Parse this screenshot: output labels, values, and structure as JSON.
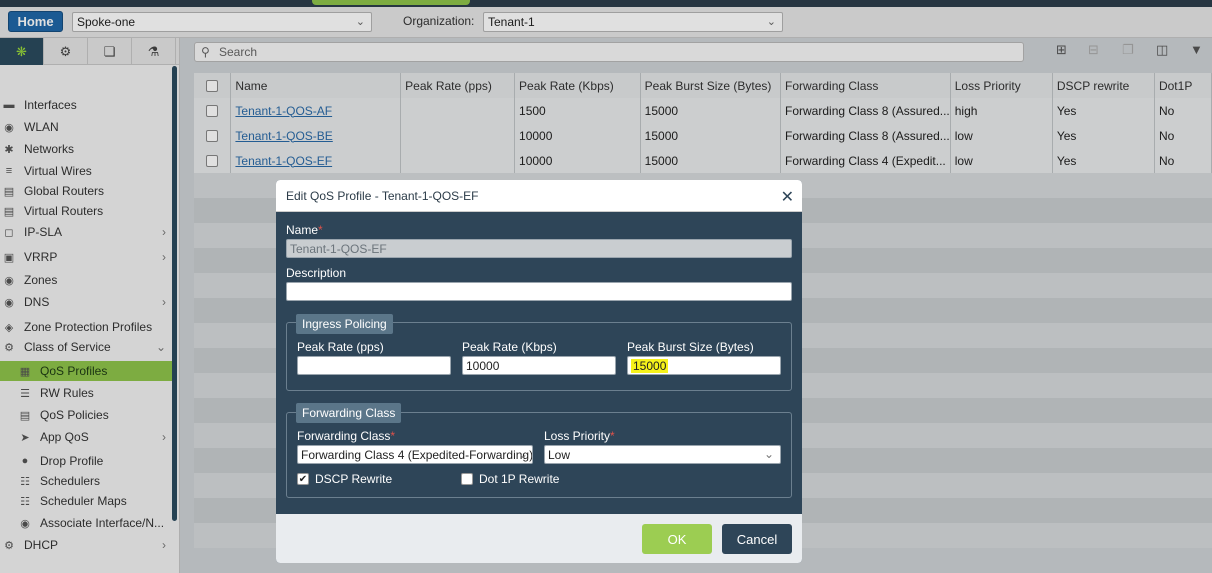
{
  "toolbar": {
    "home": "Home",
    "device": "Spoke-one",
    "org_label": "Organization:",
    "org": "Tenant-1"
  },
  "sidebar": {
    "items": [
      {
        "label": "Interfaces",
        "icon": "interface-icon",
        "has_arrow": false
      },
      {
        "label": "WLAN",
        "icon": "wifi-icon",
        "has_arrow": false
      },
      {
        "label": "Networks",
        "icon": "network-icon",
        "has_arrow": false
      },
      {
        "label": "Virtual Wires",
        "icon": "wire-icon",
        "has_arrow": false
      },
      {
        "label": "Global Routers",
        "icon": "router-icon",
        "has_arrow": false
      },
      {
        "label": "Virtual Routers",
        "icon": "router-icon",
        "has_arrow": false
      },
      {
        "label": "IP-SLA",
        "icon": "sla-icon",
        "has_arrow": true
      },
      {
        "label": "VRRP",
        "icon": "vrrp-icon",
        "has_arrow": true
      },
      {
        "label": "Zones",
        "icon": "zones-icon",
        "has_arrow": false
      },
      {
        "label": "DNS",
        "icon": "dns-icon",
        "has_arrow": true
      },
      {
        "label": "Zone Protection Profiles",
        "icon": "shield-icon",
        "has_arrow": false
      },
      {
        "label": "Class of Service",
        "icon": "cos-icon",
        "has_arrow": true
      },
      {
        "label": "QoS Profiles",
        "icon": "qos-icon",
        "has_arrow": false
      },
      {
        "label": "RW Rules",
        "icon": "rules-icon",
        "has_arrow": false
      },
      {
        "label": "QoS Policies",
        "icon": "policy-icon",
        "has_arrow": false
      },
      {
        "label": "App QoS",
        "icon": "app-icon",
        "has_arrow": true
      },
      {
        "label": "Drop Profile",
        "icon": "drop-icon",
        "has_arrow": false
      },
      {
        "label": "Schedulers",
        "icon": "scheduler-icon",
        "has_arrow": false
      },
      {
        "label": "Scheduler Maps",
        "icon": "map-icon",
        "has_arrow": false
      },
      {
        "label": "Associate Interface/N...",
        "icon": "associate-icon",
        "has_arrow": false
      },
      {
        "label": "DHCP",
        "icon": "dhcp-icon",
        "has_arrow": true
      }
    ]
  },
  "search": {
    "placeholder": "Search"
  },
  "table": {
    "headers": [
      "Name",
      "Peak Rate (pps)",
      "Peak Rate (Kbps)",
      "Peak Burst Size (Bytes)",
      "Forwarding Class",
      "Loss Priority",
      "DSCP rewrite",
      "Dot1P"
    ],
    "rows": [
      [
        "Tenant-1-QOS-AF",
        "",
        "1500",
        "15000",
        "Forwarding Class 8 (Assured...",
        "high",
        "Yes",
        "No"
      ],
      [
        "Tenant-1-QOS-BE",
        "",
        "10000",
        "15000",
        "Forwarding Class 8 (Assured...",
        "low",
        "Yes",
        "No"
      ],
      [
        "Tenant-1-QOS-EF",
        "",
        "10000",
        "15000",
        "Forwarding Class 4 (Expedit...",
        "low",
        "Yes",
        "No"
      ]
    ]
  },
  "modal": {
    "title": "Edit QoS Profile - Tenant-1-QOS-EF",
    "name_label": "Name",
    "name_value": "Tenant-1-QOS-EF",
    "desc_label": "Description",
    "desc_value": "",
    "ingress_legend": "Ingress Policing",
    "pps_label": "Peak Rate (pps)",
    "pps_value": "",
    "kbps_label": "Peak Rate (Kbps)",
    "kbps_value": "10000",
    "burst_label": "Peak Burst Size (Bytes)",
    "burst_value": "15000",
    "fc_legend": "Forwarding Class",
    "fc_label": "Forwarding Class",
    "fc_value": "Forwarding Class 4 (Expedited-Forwarding)",
    "lp_label": "Loss Priority",
    "lp_value": "Low",
    "dscp_label": "DSCP Rewrite",
    "dscp_checked": true,
    "dot1p_label": "Dot 1P Rewrite",
    "dot1p_checked": false,
    "ok": "OK",
    "cancel": "Cancel"
  },
  "colors": {
    "accent_green": "#8fc44b",
    "nav_dark": "#2b4a5e",
    "modal_bg": "#2e4558",
    "highlight": "#f6f21a"
  }
}
